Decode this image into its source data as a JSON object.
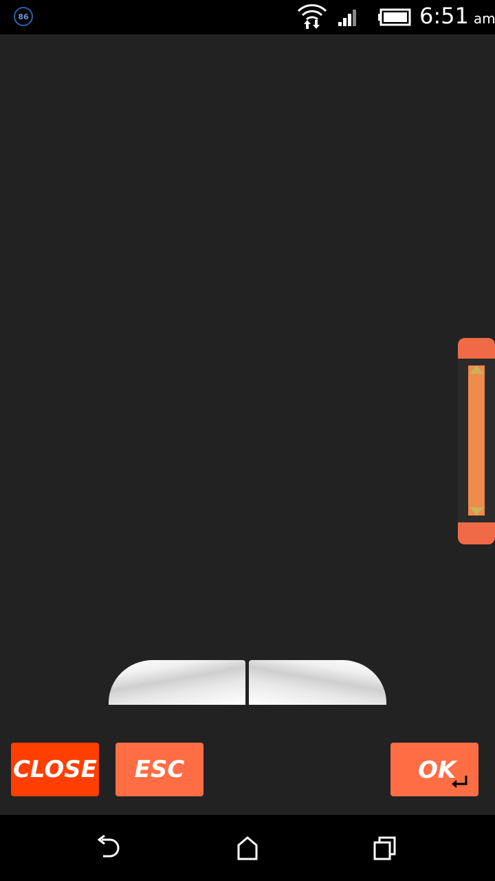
{
  "status_bar": {
    "notification_badge": "86",
    "time": "6:51",
    "ampm": "am",
    "icons": [
      "wifi-icon",
      "signal-icon",
      "battery-icon"
    ]
  },
  "scroll_wheel": {
    "up_icon": "triangle-up-icon",
    "down_icon": "triangle-down-icon"
  },
  "buttons": {
    "close_label": "CLOSE",
    "esc_label": "ESC",
    "ok_label": "OK",
    "ok_icon": "enter-icon"
  },
  "nav_bar": {
    "icons": [
      "back-icon",
      "home-icon",
      "recents-icon"
    ]
  },
  "colors": {
    "background": "#222222",
    "close_button": "#ff3f00",
    "accent_button": "#ff6d44",
    "scroll_wheel": "#f06a47"
  }
}
